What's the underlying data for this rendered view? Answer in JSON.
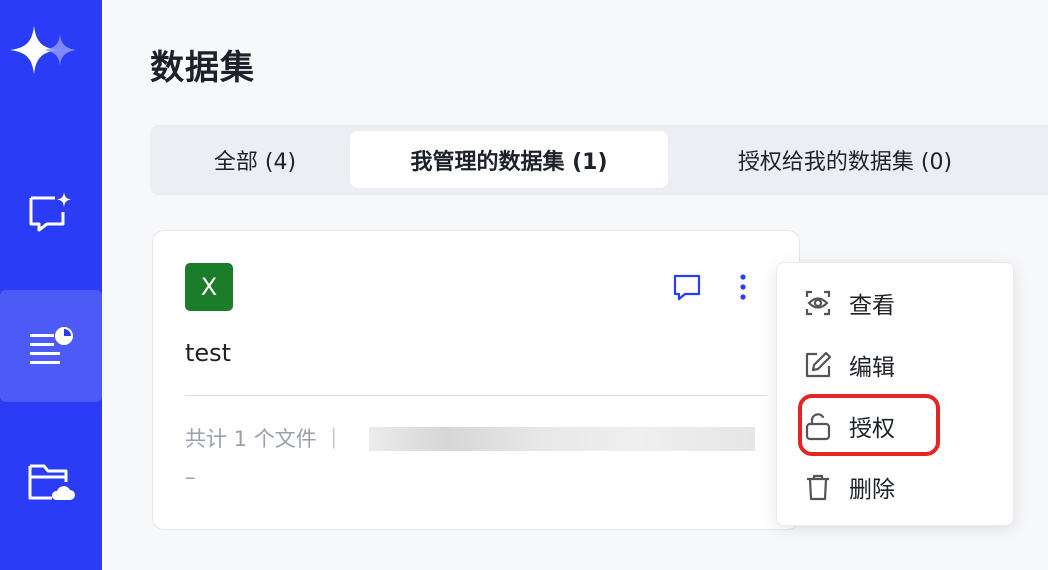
{
  "app": {
    "page_title": "数据集"
  },
  "sidebar": {
    "items": [
      {
        "icon": "chat-sparkle-icon"
      },
      {
        "icon": "dataset-list-icon",
        "active": true
      },
      {
        "icon": "cloud-folder-icon"
      }
    ]
  },
  "tabs": [
    {
      "label": "全部 (4)"
    },
    {
      "label": "我管理的数据集 (1)",
      "selected": true
    },
    {
      "label": "授权给我的数据集 (0)"
    }
  ],
  "card": {
    "file_type_label": "X",
    "name": "test",
    "meta": "共计 1 个文件 ｜",
    "secondary": "–"
  },
  "menu": {
    "items": [
      {
        "label": "查看",
        "icon": "eye-icon"
      },
      {
        "label": "编辑",
        "icon": "edit-icon"
      },
      {
        "label": "授权",
        "icon": "unlock-icon",
        "highlighted": true
      },
      {
        "label": "删除",
        "icon": "trash-icon"
      }
    ]
  },
  "colors": {
    "sidebar": "#2a3cf5",
    "accent": "#2a3cf5",
    "excel_green": "#1b7d2a",
    "highlight_red": "#e52424"
  }
}
